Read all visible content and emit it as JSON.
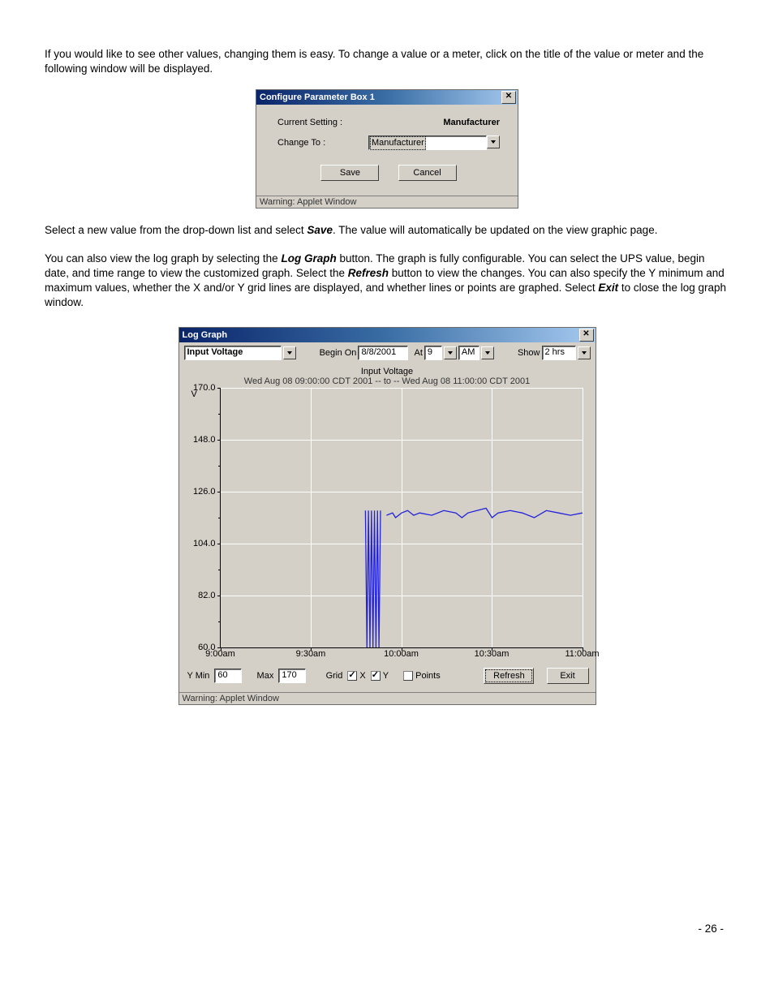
{
  "para1": "If you would like to see other values, changing them is easy.  To change a value or a meter, click on the title of the value or meter and the following window will be displayed.",
  "para2_a": "Select a new value from the drop-down list and select ",
  "para2_save": "Save",
  "para2_b": ".  The value will automatically be updated on the view graphic page.",
  "para3_a": "You can also view the log graph by selecting the ",
  "para3_log": "Log Graph",
  "para3_b": " button.  The graph is fully configurable.  You can select the UPS value, begin date, and time range to view the customized graph.  Select the ",
  "para3_refresh": "Refresh",
  "para3_c": " button to view the changes.  You can also specify the Y minimum and maximum values, whether the X and/or Y grid lines are displayed, and whether lines or points are graphed.  Select ",
  "para3_exit": "Exit",
  "para3_d": " to close the log graph window.",
  "page_num": "- 26 -",
  "cfg": {
    "title": "Configure Parameter Box 1",
    "cursetting_lbl": "Current Setting :",
    "cursetting_val": "Manufacturer",
    "changeto_lbl": "Change To :",
    "changeto_val": "Manufacturer",
    "save": "Save",
    "cancel": "Cancel",
    "status": "Warning: Applet Window"
  },
  "log": {
    "title": "Log Graph",
    "parameter": "Input Voltage",
    "begin_lbl": "Begin On",
    "begin_val": "8/8/2001",
    "at_lbl": "At",
    "at_val": "9",
    "ampm": "AM",
    "show_lbl": "Show",
    "show_val": "2 hrs",
    "ymin_lbl": "Y Min",
    "ymin_val": "60",
    "max_lbl": "Max",
    "max_val": "170",
    "grid_lbl": "Grid",
    "grid_x": "X",
    "grid_y": "Y",
    "points_lbl": "Points",
    "refresh": "Refresh",
    "exit": "Exit",
    "status": "Warning: Applet Window"
  },
  "chart_data": {
    "type": "line",
    "title": "Input Voltage",
    "subtitle": "Wed Aug 08 09:00:00 CDT 2001 -- to -- Wed Aug 08 11:00:00 CDT 2001",
    "ylabel_unit": "V",
    "ylim": [
      60,
      170
    ],
    "y_ticks": [
      60.0,
      82.0,
      104.0,
      126.0,
      148.0,
      170.0
    ],
    "x_range_minutes": [
      0,
      120
    ],
    "x_tick_minutes": [
      0,
      30,
      60,
      90,
      120
    ],
    "x_tick_labels": [
      "9:00am",
      "9:30am",
      "10:00am",
      "10:30am",
      "11:00am"
    ],
    "break_at_min": 53,
    "series": [
      {
        "name": "Input Voltage",
        "color": "#2222dd",
        "points": [
          [
            48,
            118
          ],
          [
            48.5,
            60
          ],
          [
            49,
            118
          ],
          [
            49.5,
            60
          ],
          [
            50,
            118
          ],
          [
            50.5,
            60
          ],
          [
            51,
            118
          ],
          [
            51.5,
            60
          ],
          [
            52,
            118
          ],
          [
            52.5,
            60
          ],
          [
            53,
            118
          ],
          [
            55,
            116
          ],
          [
            57,
            117
          ],
          [
            58,
            115
          ],
          [
            60,
            117
          ],
          [
            62,
            118
          ],
          [
            64,
            116
          ],
          [
            66,
            117
          ],
          [
            70,
            116
          ],
          [
            74,
            118
          ],
          [
            78,
            117
          ],
          [
            80,
            115
          ],
          [
            82,
            117
          ],
          [
            85,
            118
          ],
          [
            88,
            119
          ],
          [
            90,
            115
          ],
          [
            92,
            117
          ],
          [
            96,
            118
          ],
          [
            100,
            117
          ],
          [
            104,
            115
          ],
          [
            108,
            118
          ],
          [
            112,
            117
          ],
          [
            116,
            116
          ],
          [
            120,
            117
          ]
        ]
      }
    ]
  }
}
